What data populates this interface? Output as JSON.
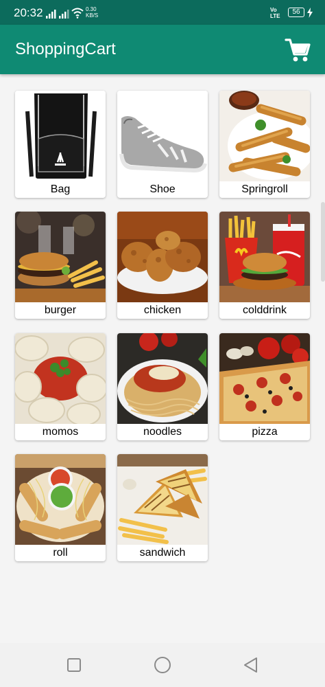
{
  "status_bar": {
    "time": "20:32",
    "net_speed_value": "0.30",
    "net_speed_unit": "KB/S",
    "volte_top": "Vo",
    "volte_bottom": "LTE",
    "battery": "56"
  },
  "app_bar": {
    "title": "ShoppingCart",
    "cart_icon": "shopping-cart-icon"
  },
  "products": [
    {
      "label": "Bag"
    },
    {
      "label": "Shoe"
    },
    {
      "label": "Springroll"
    },
    {
      "label": "burger"
    },
    {
      "label": "chicken"
    },
    {
      "label": "colddrink"
    },
    {
      "label": "momos"
    },
    {
      "label": "noodles"
    },
    {
      "label": "pizza"
    },
    {
      "label": "roll"
    },
    {
      "label": "sandwich"
    }
  ],
  "nav_bar": {
    "recent_icon": "square-icon",
    "home_icon": "circle-icon",
    "back_icon": "triangle-back-icon"
  },
  "colors": {
    "status_bar": "#0c6b5c",
    "app_bar": "#0f8a73",
    "background": "#f4f4f4"
  }
}
